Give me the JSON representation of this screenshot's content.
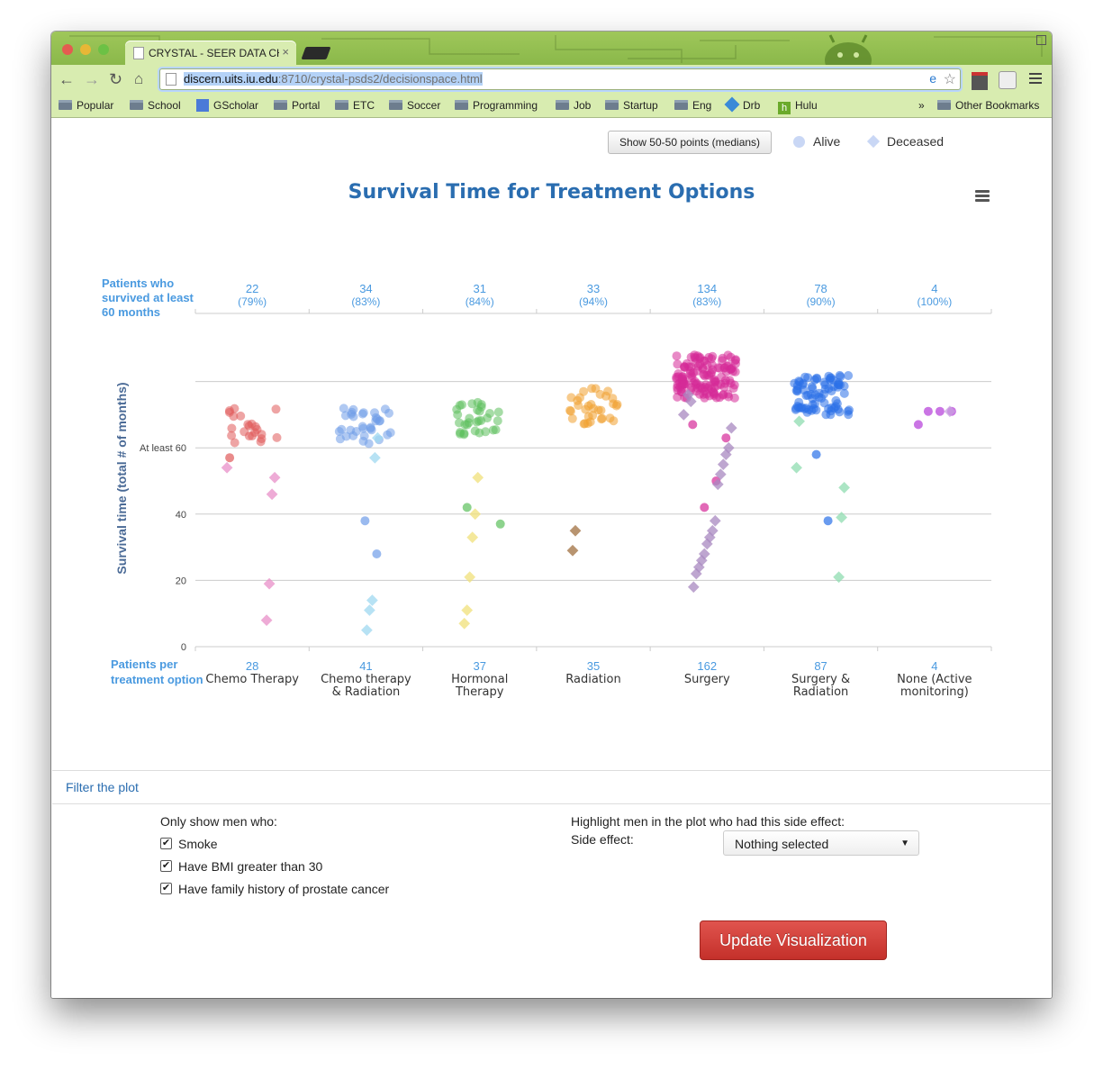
{
  "browser": {
    "tab_title": "CRYSTAL - SEER DATA CH...",
    "tab_close": "×",
    "url_host": "discern.uits.iu.edu",
    "url_rest": ":8710/crystal-psds2/decisionspace.html",
    "bookmarks": [
      "Popular",
      "School",
      "GScholar",
      "Portal",
      "ETC",
      "Soccer",
      "Programming",
      "Job",
      "Startup",
      "Eng",
      "Drb",
      "Hulu"
    ],
    "overflow": "»",
    "other_bookmarks": "Other Bookmarks"
  },
  "page": {
    "medians_button": "Show 50-50 points (medians)",
    "legend_alive": "Alive",
    "legend_deceased": "Deceased",
    "title": "Survival Time for Treatment Options"
  },
  "chart_data": {
    "type": "scatter",
    "title": "Survival Time for Treatment Options",
    "xlabel": "Treatment Option",
    "ylabel": "Survival time (total # of months)",
    "y_ticks": [
      "0",
      "20",
      "40",
      "At least 60"
    ],
    "ylim": [
      0,
      90
    ],
    "top_label": "Patients who survived at least 60 months",
    "bottom_label": "Patients per treatment option",
    "grid": true,
    "legend": "top-right",
    "categories": [
      {
        "name": "Chemo Therapy",
        "total": "28",
        "survived": "22",
        "survived_pct": "(79%)",
        "color": "#e05a5a"
      },
      {
        "name": "Chemo therapy & Radiation",
        "total": "41",
        "survived": "34",
        "survived_pct": "(83%)",
        "color": "#6f9de8"
      },
      {
        "name": "Hormonal Therapy",
        "total": "37",
        "survived": "31",
        "survived_pct": "(84%)",
        "color": "#5cc05c"
      },
      {
        "name": "Radiation",
        "total": "35",
        "survived": "33",
        "survived_pct": "(94%)",
        "color": "#f0a030"
      },
      {
        "name": "Surgery",
        "total": "162",
        "survived": "134",
        "survived_pct": "(83%)",
        "color": "#d62a98"
      },
      {
        "name": "Surgery & Radiation",
        "total": "87",
        "survived": "78",
        "survived_pct": "(90%)",
        "color": "#2a70e8"
      },
      {
        "name": "None (Active monitoring)",
        "total": "4",
        "survived": "4",
        "survived_pct": "(100%)",
        "color": "#b43ad8"
      }
    ],
    "series": [
      {
        "name": "Deceased",
        "marker": "diamond",
        "points": [
          [
            0,
            54
          ],
          [
            0,
            51
          ],
          [
            0,
            46
          ],
          [
            0,
            19
          ],
          [
            0,
            8
          ],
          [
            1,
            63
          ],
          [
            1,
            57
          ],
          [
            1,
            14
          ],
          [
            1,
            11
          ],
          [
            1,
            5
          ],
          [
            2,
            51
          ],
          [
            2,
            40
          ],
          [
            2,
            33
          ],
          [
            2,
            21
          ],
          [
            2,
            11
          ],
          [
            2,
            7
          ],
          [
            3,
            35
          ],
          [
            3,
            29
          ],
          [
            4,
            70
          ],
          [
            4,
            66
          ],
          [
            4,
            60
          ],
          [
            4,
            58
          ],
          [
            4,
            55
          ],
          [
            4,
            52
          ],
          [
            4,
            49
          ],
          [
            4,
            38
          ],
          [
            4,
            35
          ],
          [
            4,
            33
          ],
          [
            4,
            31
          ],
          [
            4,
            28
          ],
          [
            4,
            26
          ],
          [
            4,
            24
          ],
          [
            4,
            22
          ],
          [
            4,
            18
          ],
          [
            4,
            74
          ],
          [
            4,
            76
          ],
          [
            5,
            68
          ],
          [
            5,
            54
          ],
          [
            5,
            48
          ],
          [
            5,
            39
          ],
          [
            5,
            21
          ],
          [
            6,
            71
          ]
        ]
      },
      {
        "name": "Alive",
        "marker": "circle",
        "summary": "dense clusters of points between 60 and 88 months per treatment",
        "points": [
          [
            0,
            57
          ],
          [
            1,
            28
          ],
          [
            1,
            38
          ],
          [
            2,
            42
          ],
          [
            2,
            37
          ],
          [
            4,
            50
          ],
          [
            4,
            42
          ],
          [
            4,
            67
          ],
          [
            4,
            63
          ],
          [
            5,
            38
          ],
          [
            5,
            58
          ],
          [
            6,
            67
          ],
          [
            6,
            71
          ],
          [
            6,
            71
          ],
          [
            6,
            71
          ]
        ]
      }
    ]
  },
  "filters": {
    "header": "Filter the plot",
    "only_show_label": "Only show men who:",
    "checkboxes": [
      {
        "label": "Smoke",
        "checked": "✔"
      },
      {
        "label": "Have BMI greater than 30",
        "checked": "✔"
      },
      {
        "label": "Have family history of prostate cancer",
        "checked": "✔"
      }
    ],
    "highlight_label": "Highlight men in the plot who had this side effect:",
    "side_effect_label": "Side effect:",
    "side_effect_value": "Nothing selected",
    "update_button": "Update Visualization"
  }
}
